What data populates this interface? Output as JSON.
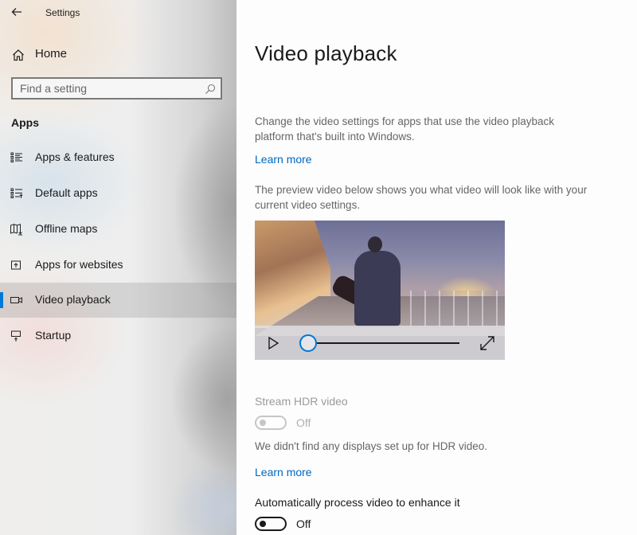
{
  "window": {
    "title": "Settings",
    "back_icon": "back-arrow-icon"
  },
  "sidebar": {
    "home": {
      "label": "Home",
      "icon": "home-icon"
    },
    "search": {
      "placeholder": "Find a setting",
      "value": "",
      "icon": "search-icon"
    },
    "section_title": "Apps",
    "items": [
      {
        "label": "Apps & features",
        "icon": "apps-features-icon",
        "active": false
      },
      {
        "label": "Default apps",
        "icon": "default-apps-icon",
        "active": false
      },
      {
        "label": "Offline maps",
        "icon": "offline-maps-icon",
        "active": false
      },
      {
        "label": "Apps for websites",
        "icon": "apps-for-websites-icon",
        "active": false
      },
      {
        "label": "Video playback",
        "icon": "video-camera-icon",
        "active": true
      },
      {
        "label": "Startup",
        "icon": "startup-icon",
        "active": false
      }
    ],
    "accent_color": "#0078d7"
  },
  "main": {
    "title": "Video playback",
    "intro": "Change the video settings for apps that use the video playback platform that's built into Windows.",
    "learn_more_1": "Learn more",
    "preview_desc": "The preview video below shows you what video will look like with your current video settings.",
    "video_preview": {
      "play_icon": "play-icon",
      "fullscreen_icon": "fullscreen-expand-icon",
      "progress": 0
    },
    "hdr": {
      "label": "Stream HDR video",
      "state": "Off",
      "enabled": false,
      "note": "We didn't find any displays set up for HDR video.",
      "learn_more": "Learn more"
    },
    "auto_process": {
      "label": "Automatically process video to enhance it",
      "state": "Off",
      "enabled": true
    },
    "link_color": "#0067c0"
  }
}
